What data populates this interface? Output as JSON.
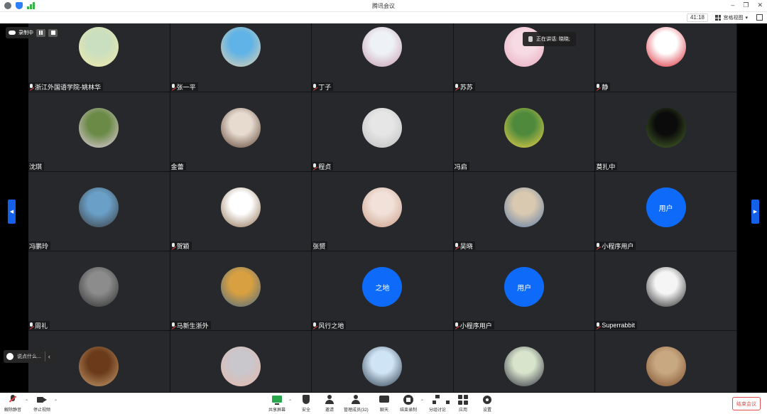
{
  "window": {
    "title": "腾讯会议",
    "timer": "41:18",
    "view_mode": "宫格视图"
  },
  "overlays": {
    "recording_label": "录制中",
    "speaking_text": "正在讲话: 晓晓;",
    "chat_placeholder": "说点什么..."
  },
  "participants": [
    {
      "name": "浙江外国语学院-姚林华",
      "muted": true,
      "avatar": {
        "type": "photo",
        "colors": [
          "#c9dfc0",
          "#f3e9a8"
        ]
      }
    },
    {
      "name": "张一平",
      "muted": true,
      "avatar": {
        "type": "photo",
        "colors": [
          "#5fb3e6",
          "#e6d2b0"
        ]
      }
    },
    {
      "name": "丁子",
      "muted": true,
      "avatar": {
        "type": "photo",
        "colors": [
          "#eef2f6",
          "#c79ab0"
        ]
      }
    },
    {
      "name": "苏苏",
      "muted": true,
      "avatar": {
        "type": "photo",
        "colors": [
          "#f7dbe4",
          "#e6a9bd"
        ]
      }
    },
    {
      "name": "静",
      "muted": true,
      "avatar": {
        "type": "photo",
        "colors": [
          "#ffffff",
          "#d61d2a"
        ]
      }
    },
    {
      "name": "沈琪",
      "muted": false,
      "avatar": {
        "type": "photo",
        "colors": [
          "#6a8a45",
          "#e8d0e8"
        ]
      }
    },
    {
      "name": "金蕾",
      "muted": false,
      "avatar": {
        "type": "photo",
        "colors": [
          "#e7dbd0",
          "#5a4030"
        ]
      }
    },
    {
      "name": "程贞",
      "muted": true,
      "avatar": {
        "type": "photo",
        "colors": [
          "#e6e6e6",
          "#bdbdbd"
        ]
      }
    },
    {
      "name": "冯启",
      "muted": false,
      "avatar": {
        "type": "photo",
        "colors": [
          "#4f8a3c",
          "#f2d34a"
        ]
      }
    },
    {
      "name": "莫扎中",
      "muted": false,
      "avatar": {
        "type": "photo",
        "colors": [
          "#0b0b0b",
          "#4a6a2a"
        ]
      }
    },
    {
      "name": "冯鹏玲",
      "muted": false,
      "avatar": {
        "type": "photo",
        "colors": [
          "#6aa0c8",
          "#3a3a3a"
        ]
      }
    },
    {
      "name": "贺颖",
      "muted": true,
      "avatar": {
        "type": "photo",
        "colors": [
          "#ffffff",
          "#8a6a4a"
        ]
      }
    },
    {
      "name": "张赟",
      "muted": false,
      "avatar": {
        "type": "photo",
        "colors": [
          "#f1e1d8",
          "#c99a85"
        ]
      }
    },
    {
      "name": "吴晓",
      "muted": true,
      "avatar": {
        "type": "photo",
        "colors": [
          "#d9c9b0",
          "#5a7aa8"
        ]
      }
    },
    {
      "name": "小程序用户",
      "muted": true,
      "avatar": {
        "type": "text",
        "text": "用户",
        "colors": [
          "#0e6bfa",
          "#0e6bfa"
        ]
      }
    },
    {
      "name": "周礼",
      "muted": true,
      "avatar": {
        "type": "photo",
        "colors": [
          "#8c8c8c",
          "#2b2b2b"
        ]
      }
    },
    {
      "name": "马新生浙外",
      "muted": true,
      "avatar": {
        "type": "photo",
        "colors": [
          "#d8a040",
          "#4a6a8a"
        ]
      }
    },
    {
      "name": "风行之地",
      "muted": true,
      "avatar": {
        "type": "text",
        "text": "之地",
        "colors": [
          "#0e6bfa",
          "#0e6bfa"
        ]
      }
    },
    {
      "name": "小程序用户",
      "muted": true,
      "avatar": {
        "type": "text",
        "text": "用户",
        "colors": [
          "#0e6bfa",
          "#0e6bfa"
        ]
      }
    },
    {
      "name": "Superrabbit",
      "muted": true,
      "avatar": {
        "type": "photo",
        "colors": [
          "#f5f5f5",
          "#222222"
        ]
      }
    },
    {
      "name": "",
      "muted": false,
      "avatar": {
        "type": "photo",
        "colors": [
          "#6a3a1a",
          "#c8a070"
        ]
      }
    },
    {
      "name": "",
      "muted": false,
      "avatar": {
        "type": "photo",
        "colors": [
          "#c9c6cc",
          "#e8b8a8"
        ]
      }
    },
    {
      "name": "",
      "muted": false,
      "avatar": {
        "type": "photo",
        "colors": [
          "#cfe4f5",
          "#2a3a4a"
        ]
      }
    },
    {
      "name": "",
      "muted": false,
      "avatar": {
        "type": "photo",
        "colors": [
          "#d8e4cc",
          "#2a2a3a"
        ]
      }
    },
    {
      "name": "",
      "muted": false,
      "avatar": {
        "type": "photo",
        "colors": [
          "#c8a880",
          "#7a4a2a"
        ]
      }
    }
  ],
  "toolbar": {
    "unmute": "解除静音",
    "stop_video": "停止视频",
    "share_screen": "共享屏幕",
    "security": "安全",
    "invite": "邀请",
    "manage_members": "管理成员(32)",
    "chat": "聊天",
    "end_recording": "结束录制",
    "breakout": "分组讨论",
    "apps": "应用",
    "settings": "设置",
    "end_meeting": "结束会议"
  },
  "colors": {
    "accent_blue": "#0e6bfa",
    "share_green": "#2aa64c",
    "end_red": "#e34d4d",
    "tile_bg": "#26282b"
  }
}
